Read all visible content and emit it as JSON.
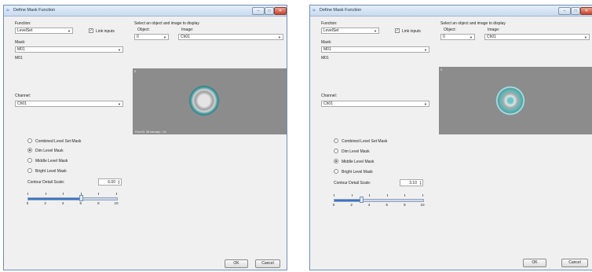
{
  "dialogs": [
    {
      "title": "Define Mask Function",
      "window_buttons": [
        "–",
        "□",
        "✕"
      ],
      "function_label": "Function:",
      "function_value": "LevelSet",
      "link_inputs_label": "Link inputs",
      "link_inputs_checked": true,
      "mask_label": "Mask:",
      "mask_value": "M01",
      "mask_info": "M01",
      "channel_label": "Channel:",
      "channel_value": "Ch01",
      "select_prompt": "Select an object and image to display",
      "object_label": "Object:",
      "object_value": "0",
      "image_label": "Image:",
      "image_value": "Ch01",
      "viewer_tag": "0",
      "viewer_footer": "Pixel ID: 38  Intensity: 744",
      "options": [
        {
          "label": "Combined Level Set Mask",
          "selected": false
        },
        {
          "label": "Dim Level Mask",
          "selected": true
        },
        {
          "label": "Middle Level Mask",
          "selected": false
        },
        {
          "label": "Bright Level Mask",
          "selected": false
        }
      ],
      "contour_label": "Contour Detail Scale:",
      "contour_value": "6.00",
      "slider_value": 6,
      "slider_ticks": [
        "0",
        "2",
        "4",
        "6",
        "8",
        "10"
      ],
      "ok_label": "OK",
      "cancel_label": "Cancel"
    },
    {
      "title": "Define Mask Function",
      "window_buttons": [
        "–",
        "□",
        "✕"
      ],
      "function_label": "Function:",
      "function_value": "LevelSet",
      "link_inputs_label": "Link inputs",
      "link_inputs_checked": true,
      "mask_label": "Mask:",
      "mask_value": "M01",
      "mask_info": "M01",
      "channel_label": "Channel:",
      "channel_value": "Ch01",
      "select_prompt": "Select an object and image to display",
      "object_label": "Object:",
      "object_value": "0",
      "image_label": "Image:",
      "image_value": "Ch01",
      "viewer_tag": "0",
      "viewer_footer": "",
      "options": [
        {
          "label": "Combined Level Set Mask",
          "selected": false
        },
        {
          "label": "Dim Level Mask",
          "selected": false
        },
        {
          "label": "Middle Level Mask",
          "selected": true
        },
        {
          "label": "Bright Level Mask",
          "selected": false
        }
      ],
      "contour_label": "Contour Detail Scale:",
      "contour_value": "3.10",
      "slider_value": 3.1,
      "slider_ticks": [
        "0",
        "2",
        "4",
        "6",
        "8",
        "10"
      ],
      "ok_label": "OK",
      "cancel_label": "Cancel"
    }
  ]
}
